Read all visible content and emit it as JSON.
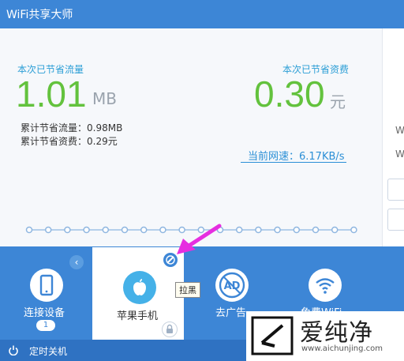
{
  "window": {
    "title": "WiFi共享大师"
  },
  "stats": {
    "traffic_label": "本次已节省流量",
    "traffic_value": "1.01",
    "traffic_unit": "MB",
    "cost_label": "本次已节省资费",
    "cost_value": "0.30",
    "cost_unit": "元",
    "total_traffic": "累计节省流量：0.98MB",
    "total_cost": "累计节省资费：0.29元",
    "speed": "当前网速：6.17KB/s"
  },
  "chart_data": {
    "type": "line",
    "values": [
      0,
      0,
      0,
      0,
      0,
      0,
      0,
      0,
      0,
      0,
      0,
      0,
      0,
      0,
      0,
      0,
      0,
      0
    ],
    "title": "",
    "xlabel": "",
    "ylabel": ""
  },
  "right_panel": {
    "text1": "W",
    "text2": "W"
  },
  "bottom": {
    "tiles": [
      {
        "label": "连接设备",
        "badge": "1",
        "icon": "phone-icon"
      },
      {
        "label": "苹果手机",
        "icon": "apple-icon"
      },
      {
        "label": "去广告",
        "icon": "ad-block-icon"
      },
      {
        "label": "免费WiFi",
        "icon": "wifi-icon"
      }
    ],
    "tooltip": "拉黑",
    "footer_label": "定时关机"
  },
  "watermark": {
    "brand": "爱纯净",
    "url": "www.aichunjing.com"
  },
  "colors": {
    "accent": "#3d86d6",
    "green": "#63c23d",
    "cyan": "#2b9ed6",
    "arrow": "#e62ee0"
  }
}
